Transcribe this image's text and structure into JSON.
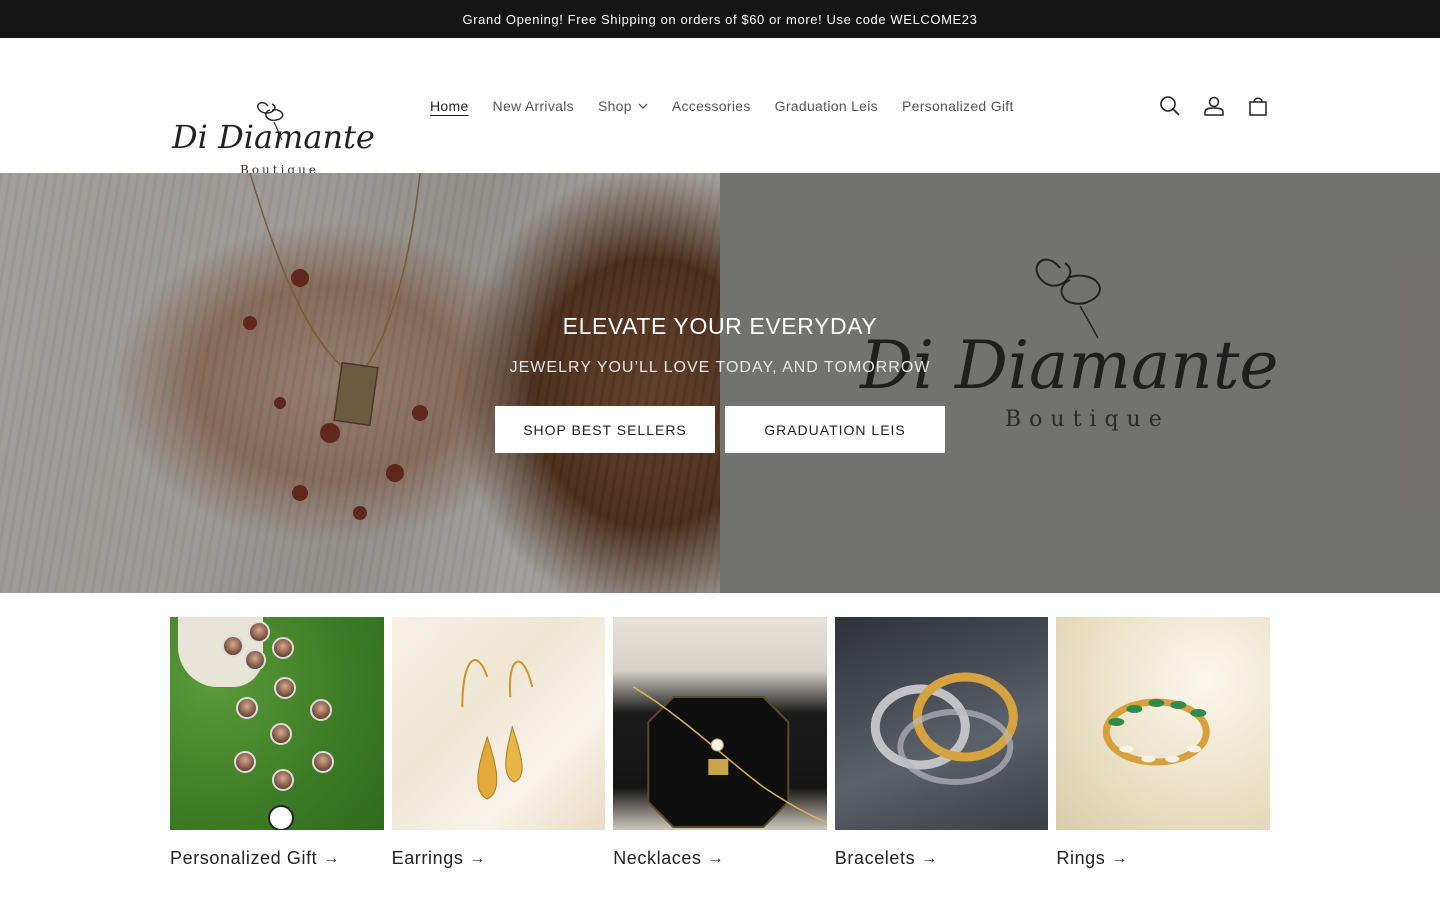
{
  "announcement": "Grand Opening! Free Shipping on orders of $60 or more! Use code WELCOME23",
  "brand": {
    "name": "Di Diamante",
    "tagline": "Boutique"
  },
  "nav": {
    "items": [
      {
        "label": "Home",
        "active": true
      },
      {
        "label": "New Arrivals"
      },
      {
        "label": "Shop",
        "dropdown": true
      },
      {
        "label": "Accessories"
      },
      {
        "label": "Graduation Leis"
      },
      {
        "label": "Personalized Gift"
      }
    ]
  },
  "header_icons": [
    "search-icon",
    "account-icon",
    "cart-icon"
  ],
  "hero": {
    "title": "ELEVATE YOUR EVERYDAY",
    "subtitle": "JEWELRY YOU’LL LOVE TODAY, AND TOMORROW",
    "buttons": [
      "SHOP BEST SELLERS",
      "GRADUATION LEIS"
    ]
  },
  "collections": [
    {
      "title": "Personalized Gift",
      "arrow": "→"
    },
    {
      "title": "Earrings",
      "arrow": "→"
    },
    {
      "title": "Necklaces",
      "arrow": "→"
    },
    {
      "title": "Bracelets",
      "arrow": "→"
    },
    {
      "title": "Rings",
      "arrow": "→"
    }
  ],
  "colors": {
    "announcement_bg": "#151515",
    "hero_overlay": "rgba(0,0,0,0.32)",
    "text": "#222222"
  }
}
